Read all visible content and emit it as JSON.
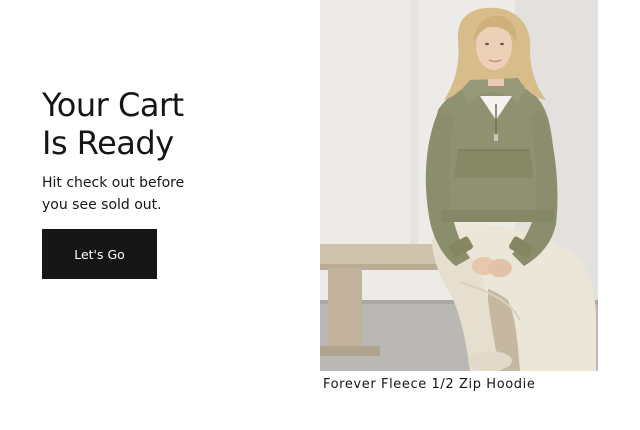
{
  "promo": {
    "headline_line1": "Your Cart",
    "headline_line2": "Is Ready",
    "subtext_line1": "Hit check out before",
    "subtext_line2": "you see sold out.",
    "cta_label": "Let's Go"
  },
  "product": {
    "name": "Forever Fleece 1/2 Zip Hoodie",
    "image_icon": "product-photo-icon",
    "colors": {
      "hoodie": "#8f9270",
      "pants": "#ece6d8",
      "bench": "#cfc2ad",
      "background": "#e9e8e5",
      "hair": "#d8bc8a"
    }
  },
  "theme": {
    "cta_background": "#161616",
    "cta_text": "#ffffff",
    "text": "#151515"
  }
}
